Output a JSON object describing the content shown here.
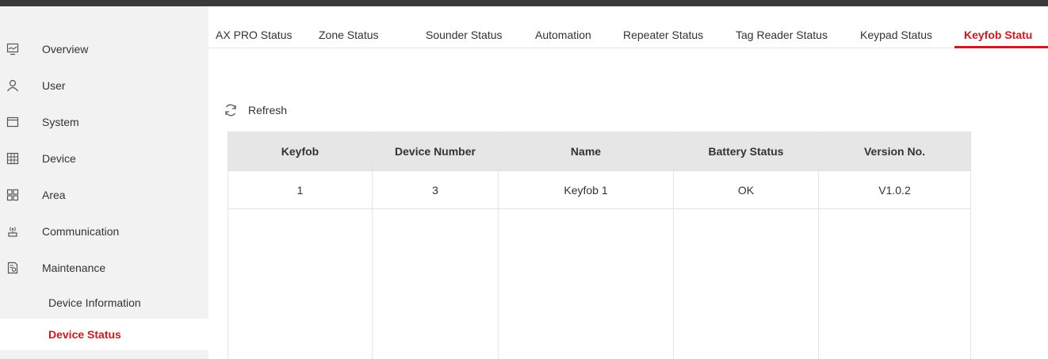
{
  "sidebar": {
    "items": [
      {
        "label": "Overview",
        "icon": "monitor-icon"
      },
      {
        "label": "User",
        "icon": "user-icon"
      },
      {
        "label": "System",
        "icon": "window-icon"
      },
      {
        "label": "Device",
        "icon": "device-grid-icon"
      },
      {
        "label": "Area",
        "icon": "area-grid-icon"
      },
      {
        "label": "Communication",
        "icon": "antenna-icon"
      },
      {
        "label": "Maintenance",
        "icon": "maintenance-icon"
      }
    ],
    "sub_items": [
      {
        "label": "Device Information",
        "active": false
      },
      {
        "label": "Device Status",
        "active": true
      }
    ]
  },
  "tabs": [
    {
      "label": "AX PRO Status",
      "active": false
    },
    {
      "label": "Zone Status",
      "active": false
    },
    {
      "label": "Sounder Status",
      "active": false
    },
    {
      "label": "Automation",
      "active": false
    },
    {
      "label": "Repeater Status",
      "active": false
    },
    {
      "label": "Tag Reader Status",
      "active": false
    },
    {
      "label": "Keypad Status",
      "active": false
    },
    {
      "label": "Keyfob Statu",
      "active": true
    }
  ],
  "toolbar": {
    "refresh_label": "Refresh",
    "refresh_icon": "refresh-icon"
  },
  "table": {
    "headers": [
      "Keyfob",
      "Device Number",
      "Name",
      "Battery Status",
      "Version No."
    ],
    "rows": [
      [
        "1",
        "3",
        "Keyfob 1",
        "OK",
        "V1.0.2"
      ]
    ]
  },
  "colors": {
    "accent": "#d0181e",
    "sidebar_bg": "#f2f2f2",
    "header_bg": "#e6e6e6"
  }
}
